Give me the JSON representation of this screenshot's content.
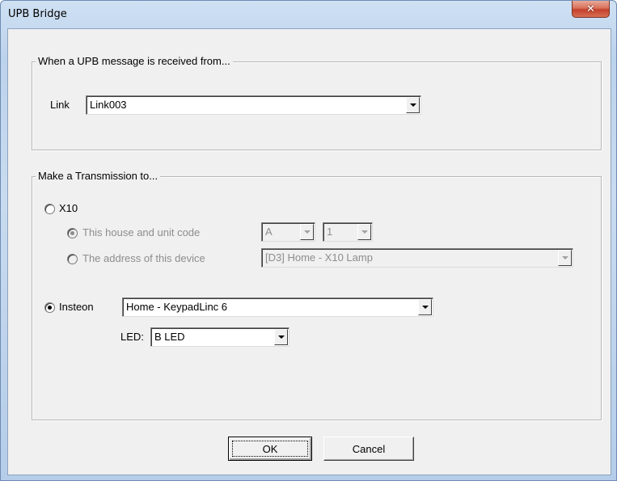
{
  "window": {
    "title": "UPB Bridge",
    "close_glyph": "✕"
  },
  "source_group": {
    "legend": "When a UPB message is received from...",
    "link_label": "Link",
    "link_value": "Link003"
  },
  "target_group": {
    "legend": "Make a Transmission to...",
    "x10": {
      "label": "X10",
      "selected": false,
      "house_unit_option": {
        "label": "This house and unit code",
        "selected": true,
        "enabled": false
      },
      "house_code": "A",
      "unit_code": "1",
      "device_option": {
        "label": "The address of this device",
        "selected": false,
        "enabled": false
      },
      "device_value": "[D3] Home - X10 Lamp"
    },
    "insteon": {
      "label": "Insteon",
      "selected": true,
      "device_value": "Home - KeypadLinc 6",
      "led_label": "LED:",
      "led_value": "B LED"
    }
  },
  "buttons": {
    "ok": "OK",
    "cancel": "Cancel"
  },
  "icons": {
    "close": "close-icon",
    "dropdown": "chevron-down-icon"
  },
  "colors": {
    "title_gradient_top": "#cfe0f3",
    "close_button_red": "#c4402a",
    "dialog_face": "#f0f0f0",
    "disabled_text": "#8d8d8d"
  }
}
